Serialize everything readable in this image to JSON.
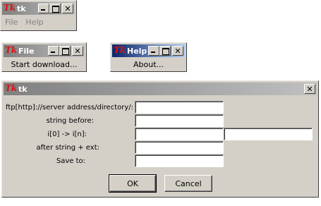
{
  "main_window": {
    "title": "tk",
    "menu": [
      "File",
      "Help"
    ]
  },
  "file_window": {
    "title": "File",
    "item": "Start download..."
  },
  "help_window": {
    "title": "Help",
    "item": "About..."
  },
  "dialog": {
    "title": "tk",
    "labels": {
      "server": "ftp[http]://server address/directory/:",
      "before": "string before:",
      "range": "i[0] -> i[n]:",
      "after": "after string  + ext:",
      "save": "Save to:"
    },
    "values": {
      "server": "",
      "before": "",
      "range_start": "",
      "range_end": "",
      "after": "",
      "save": ""
    },
    "ok_label": "OK",
    "cancel_label": "Cancel"
  },
  "icons": {
    "app": "tk-logo-icon",
    "minimize": "minimize-icon",
    "maximize": "maximize-icon",
    "close": "close-icon"
  },
  "colors": {
    "face": "#d4d0c8",
    "title_active": "#0a246a",
    "title_inactive": "#808080",
    "tk_red": "#e01010"
  }
}
